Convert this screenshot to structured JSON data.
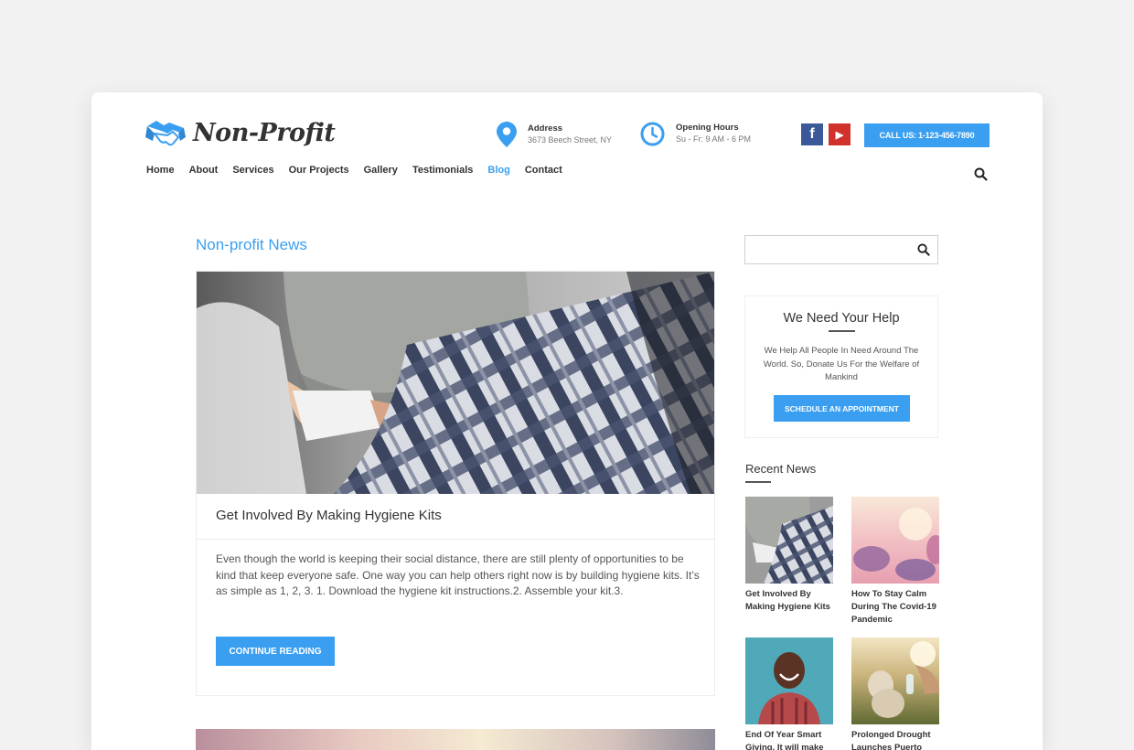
{
  "header": {
    "logo_text": "Non-Profit",
    "address": {
      "title": "Address",
      "value": "3673 Beech Street, NY"
    },
    "hours": {
      "title": "Opening Hours",
      "value": "Su - Fr: 9 AM - 6 PM"
    },
    "social": [
      {
        "icon": "facebook-icon",
        "glyph": "f",
        "color": "#3b5998"
      },
      {
        "icon": "youtube-icon",
        "glyph": "▶",
        "color": "#d0312d"
      }
    ],
    "call_label": "CALL US: 1-123-456-7890"
  },
  "nav": {
    "items": [
      {
        "label": "Home",
        "active": false
      },
      {
        "label": "About",
        "active": false
      },
      {
        "label": "Services",
        "active": false
      },
      {
        "label": "Our Projects",
        "active": false
      },
      {
        "label": "Gallery",
        "active": false
      },
      {
        "label": "Testimonials",
        "active": false
      },
      {
        "label": "Blog",
        "active": true
      },
      {
        "label": "Contact",
        "active": false
      }
    ]
  },
  "main": {
    "section_title": "Non-profit News",
    "post": {
      "title": "Get Involved By Making Hygiene Kits",
      "excerpt": "Even though the world is keeping their social distance, there are still plenty of opportunities to be kind that keep everyone safe. One way you can help others right now is by building hygiene kits. It’s as simple as 1, 2, 3. 1.  Download the hygiene kit instructions.2.  Assemble your kit.3.",
      "button_label": "CONTINUE READING"
    }
  },
  "sidebar": {
    "search": {
      "value": "",
      "placeholder": ""
    },
    "help": {
      "title": "We Need Your Help",
      "text": "We Help All People In Need Around The World. So, Donate Us For the Welfare of Mankind",
      "button_label": "SCHEDULE AN APPOINTMENT"
    },
    "recent_title": "Recent News",
    "recent": [
      {
        "caption": "Get Involved By Making Hygiene Kits"
      },
      {
        "caption": "How To Stay Calm During The Covid-19 Pandemic"
      },
      {
        "caption": "End Of Year Smart Giving. It will make"
      },
      {
        "caption": "Prolonged Drought Launches Puerto"
      }
    ]
  },
  "colors": {
    "accent": "#3a9ff0",
    "text": "#333333",
    "background": "#f2f2f2"
  }
}
